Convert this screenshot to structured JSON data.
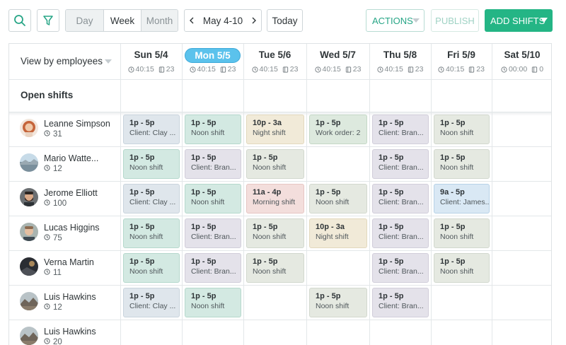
{
  "toolbar": {
    "views": [
      "Day",
      "Week",
      "Month"
    ],
    "selected_view": "Week",
    "date_range": "May 4-10",
    "today_label": "Today",
    "actions_label": "ACTIONS",
    "publish_label": "PUBLISH",
    "add_shifts_label": "ADD SHIFTS"
  },
  "grid": {
    "view_by_label": "View by employees",
    "open_shifts_label": "Open shifts",
    "days": [
      {
        "label": "Sun 5/4",
        "hours": "40:15",
        "count": "23",
        "today": false
      },
      {
        "label": "Mon 5/5",
        "hours": "40:15",
        "count": "23",
        "today": true
      },
      {
        "label": "Tue 5/6",
        "hours": "40:15",
        "count": "23",
        "today": false
      },
      {
        "label": "Wed 5/7",
        "hours": "40:15",
        "count": "23",
        "today": false
      },
      {
        "label": "Thu 5/8",
        "hours": "40:15",
        "count": "23",
        "today": false
      },
      {
        "label": "Fri 5/9",
        "hours": "40:15",
        "count": "23",
        "today": false
      },
      {
        "label": "Sat 5/10",
        "hours": "00:00",
        "count": "0",
        "today": false
      }
    ],
    "employees": [
      {
        "name": "Leanne Simpson",
        "hours": "31",
        "avatar": "woman-red-hair",
        "shifts": [
          {
            "day": 0,
            "time": "1p - 5p",
            "desc": "Client: Clay ...",
            "color": "blue"
          },
          {
            "day": 1,
            "time": "1p - 5p",
            "desc": "Noon shift",
            "color": "teal"
          },
          {
            "day": 2,
            "time": "10p - 3a",
            "desc": "Night shift",
            "color": "cream"
          },
          {
            "day": 3,
            "time": "1p - 5p",
            "desc": "Work order: 2",
            "color": "mint"
          },
          {
            "day": 4,
            "time": "1p - 5p",
            "desc": "Client: Bran...",
            "color": "lav"
          },
          {
            "day": 5,
            "time": "1p - 5p",
            "desc": "Noon shift",
            "color": "grey"
          }
        ]
      },
      {
        "name": "Mario Watte...",
        "hours": "12",
        "avatar": "landscape",
        "shifts": [
          {
            "day": 0,
            "time": "1p - 5p",
            "desc": "Noon shift",
            "color": "teal"
          },
          {
            "day": 1,
            "time": "1p - 5p",
            "desc": "Client: Bran...",
            "color": "lav"
          },
          {
            "day": 2,
            "time": "1p - 5p",
            "desc": "Noon shift",
            "color": "grey"
          },
          {
            "day": 4,
            "time": "1p - 5p",
            "desc": "Client: Bran...",
            "color": "lav"
          },
          {
            "day": 5,
            "time": "1p - 5p",
            "desc": "Noon shift",
            "color": "grey"
          }
        ]
      },
      {
        "name": "Jerome Elliott",
        "hours": "100",
        "avatar": "man-beard",
        "shifts": [
          {
            "day": 0,
            "time": "1p - 5p",
            "desc": "Client: Clay ...",
            "color": "blue"
          },
          {
            "day": 1,
            "time": "1p - 5p",
            "desc": "Noon shift",
            "color": "teal"
          },
          {
            "day": 2,
            "time": "11a - 4p",
            "desc": "Morning shift",
            "color": "pink"
          },
          {
            "day": 3,
            "time": "1p - 5p",
            "desc": "Noon shift",
            "color": "grey"
          },
          {
            "day": 4,
            "time": "1p - 5p",
            "desc": "Client: Bran...",
            "color": "lav"
          },
          {
            "day": 5,
            "time": "9a - 5p",
            "desc": "Client: James...",
            "color": "sky"
          }
        ]
      },
      {
        "name": "Lucas Higgins",
        "hours": "75",
        "avatar": "man-young",
        "shifts": [
          {
            "day": 0,
            "time": "1p - 5p",
            "desc": "Noon shift",
            "color": "teal"
          },
          {
            "day": 1,
            "time": "1p - 5p",
            "desc": "Client: Bran...",
            "color": "lav"
          },
          {
            "day": 2,
            "time": "1p - 5p",
            "desc": "Noon shift",
            "color": "grey"
          },
          {
            "day": 3,
            "time": "10p - 3a",
            "desc": "Night shift",
            "color": "cream"
          },
          {
            "day": 4,
            "time": "1p - 5p",
            "desc": "Client: Bran...",
            "color": "lav"
          },
          {
            "day": 5,
            "time": "1p - 5p",
            "desc": "Noon shift",
            "color": "grey"
          }
        ]
      },
      {
        "name": "Verna Martin",
        "hours": "11",
        "avatar": "dark-scene",
        "shifts": [
          {
            "day": 0,
            "time": "1p - 5p",
            "desc": "Noon shift",
            "color": "teal"
          },
          {
            "day": 1,
            "time": "1p - 5p",
            "desc": "Client: Bran...",
            "color": "lav"
          },
          {
            "day": 2,
            "time": "1p - 5p",
            "desc": "Noon shift",
            "color": "grey"
          },
          {
            "day": 4,
            "time": "1p - 5p",
            "desc": "Client: Bran...",
            "color": "lav"
          },
          {
            "day": 5,
            "time": "1p - 5p",
            "desc": "Noon shift",
            "color": "grey"
          }
        ]
      },
      {
        "name": "Luis Hawkins",
        "hours": "12",
        "avatar": "mountain",
        "shifts": [
          {
            "day": 0,
            "time": "1p - 5p",
            "desc": "Client: Clay ...",
            "color": "blue"
          },
          {
            "day": 1,
            "time": "1p - 5p",
            "desc": "Noon shift",
            "color": "teal"
          },
          {
            "day": 3,
            "time": "1p - 5p",
            "desc": "Noon shift",
            "color": "grey"
          },
          {
            "day": 4,
            "time": "1p - 5p",
            "desc": "Client: Bran...",
            "color": "lav"
          }
        ]
      },
      {
        "name": "Luis Hawkins",
        "hours": "20",
        "avatar": "mountain",
        "shifts": []
      }
    ]
  }
}
